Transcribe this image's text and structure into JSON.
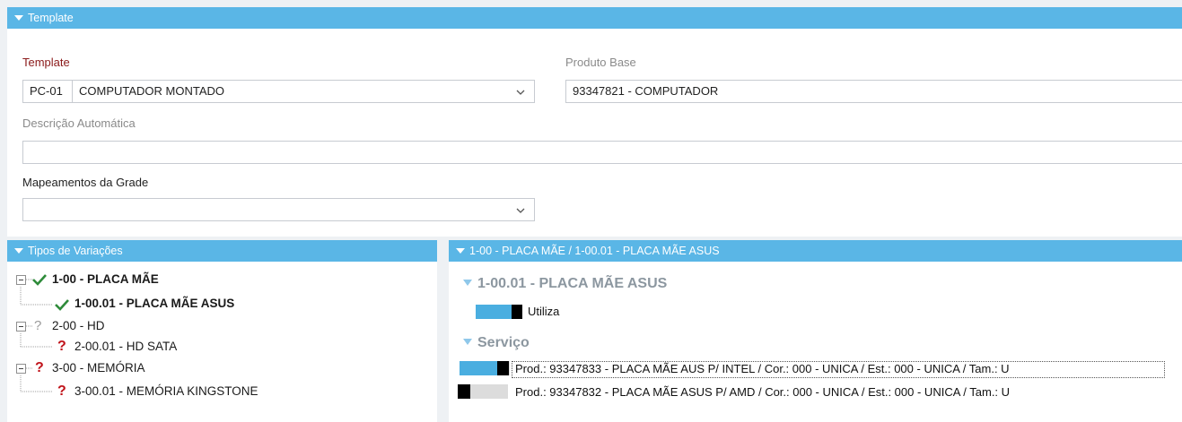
{
  "template_panel": {
    "header": "Template",
    "template_label": "Template",
    "template_code": "PC-01",
    "template_name": "COMPUTADOR MONTADO",
    "produto_base_label": "Produto Base",
    "produto_base_value": "93347821 - COMPUTADOR",
    "descricao_label": "Descrição Automática",
    "descricao_value": "",
    "mapeamentos_label": "Mapeamentos da Grade",
    "mapeamentos_value": ""
  },
  "variacoes_panel": {
    "header": "Tipos de Variações",
    "tree": [
      {
        "label": "1-00 - PLACA MÃE",
        "icon": "check-icon",
        "level": 0,
        "bold": true
      },
      {
        "label": "1-00.01 - PLACA MÃE ASUS",
        "icon": "check-icon",
        "level": 1,
        "bold": true
      },
      {
        "label": "2-00 - HD",
        "icon": "question-grey-icon",
        "level": 0,
        "bold": false
      },
      {
        "label": "2-00.01 - HD SATA",
        "icon": "question-red-icon",
        "level": 1,
        "bold": false
      },
      {
        "label": "3-00 - MEMÓRIA",
        "icon": "question-red-icon",
        "level": 0,
        "bold": false
      },
      {
        "label": "3-00.01 - MEMÓRIA KINGSTONE",
        "icon": "question-red-icon",
        "level": 1,
        "bold": false
      }
    ]
  },
  "detail_panel": {
    "header": "1-00 - PLACA MÃE / 1-00.01 - PLACA MÃE ASUS",
    "section_title": "1-00.01 - PLACA MÃE ASUS",
    "utiliza_label": "Utiliza",
    "utiliza_on": true,
    "servico_title": "Serviço",
    "servico_rows": [
      {
        "text": "Prod.: 93347833 - PLACA MÃE AUS P/ INTEL /  Cor.: 000 - UNICA /  Est.: 000 - UNICA /  Tam.: U",
        "on": true
      },
      {
        "text": "Prod.: 93347832 - PLACA MÃE ASUS P/ AMD /  Cor.: 000 - UNICA /  Est.: 000 - UNICA /  Tam.: U",
        "on": false
      }
    ]
  },
  "colors": {
    "header_blue": "#5ab6e6",
    "toggle_blue": "#4aaee0",
    "check_green": "#2e8b3a",
    "question_red": "#c0141b",
    "label_red": "#8b1a1a"
  }
}
